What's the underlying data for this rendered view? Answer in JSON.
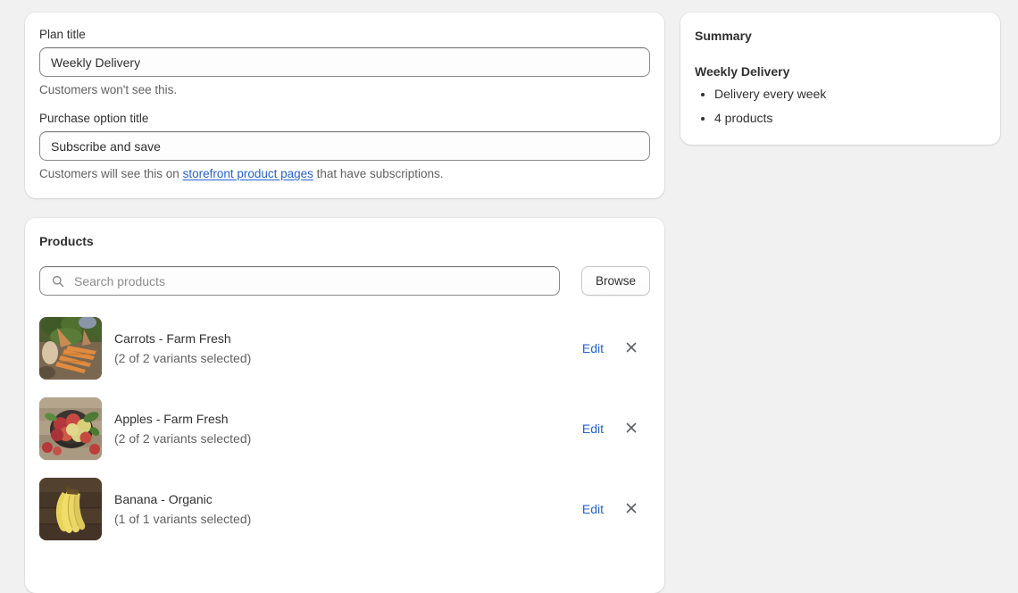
{
  "details_card": {
    "plan_title": {
      "label": "Plan title",
      "value": "Weekly Delivery",
      "placeholder": "",
      "help": "Customers won't see this."
    },
    "purchase_option_title": {
      "label": "Purchase option title",
      "value": "Subscribe and save",
      "placeholder": "",
      "help_prefix": "Customers will see this on ",
      "help_link": "storefront product pages",
      "help_suffix": " that have subscriptions."
    }
  },
  "products_card": {
    "title": "Products",
    "search": {
      "placeholder": "Search products",
      "value": "",
      "icon": "search-icon"
    },
    "browse_label": "Browse",
    "row_actions": {
      "edit_label": "Edit",
      "remove_icon": "close-icon"
    },
    "items": [
      {
        "name": "Carrots - Farm Fresh",
        "variants": "(2 of 2 variants selected)",
        "thumb": "carrots-photo"
      },
      {
        "name": "Apples - Farm Fresh",
        "variants": "(2 of 2 variants selected)",
        "thumb": "apples-photo"
      },
      {
        "name": "Banana - Organic",
        "variants": "(1 of 1 variants selected)",
        "thumb": "banana-photo"
      }
    ]
  },
  "summary_card": {
    "title": "Summary",
    "plan_name": "Weekly Delivery",
    "bullets": [
      "Delivery every week",
      "4 products"
    ]
  },
  "colors": {
    "page_background": "#f1f1f1",
    "card_background": "#ffffff",
    "text_primary": "#303030",
    "text_subdued": "#616161",
    "link": "#2463d1",
    "input_border": "#8a8a8a"
  }
}
